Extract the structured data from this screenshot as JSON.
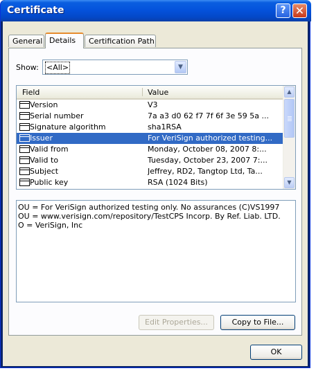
{
  "window": {
    "title": "Certificate"
  },
  "titlebar": {
    "help_glyph": "?",
    "close_glyph": "✕"
  },
  "tabs": [
    {
      "label": "General"
    },
    {
      "label": "Details"
    },
    {
      "label": "Certification Path"
    }
  ],
  "show": {
    "label": "Show:",
    "selected": "<All>"
  },
  "list": {
    "columns": [
      "Field",
      "Value"
    ],
    "rows": [
      {
        "field": "Version",
        "value": "V3"
      },
      {
        "field": "Serial number",
        "value": "7a a3 d0 62 f7 7f 6f 3e 59 5a ..."
      },
      {
        "field": "Signature algorithm",
        "value": "sha1RSA"
      },
      {
        "field": "Issuer",
        "value": "For VeriSign authorized testing..."
      },
      {
        "field": "Valid from",
        "value": "Monday, October 08, 2007 8:..."
      },
      {
        "field": "Valid to",
        "value": "Tuesday, October 23, 2007 7:..."
      },
      {
        "field": "Subject",
        "value": "Jeffrey, RD2, Tangtop Ltd, Ta..."
      },
      {
        "field": "Public key",
        "value": "RSA (1024 Bits)"
      }
    ],
    "selected_index": 3
  },
  "detail": {
    "lines": [
      "OU = For VeriSign authorized testing only. No assurances (C)VS1997",
      "OU = www.verisign.com/repository/TestCPS Incorp. By Ref. Liab. LTD.",
      "O = VeriSign, Inc"
    ]
  },
  "buttons": {
    "edit_properties": "Edit Properties...",
    "copy_to_file": "Copy to File...",
    "ok": "OK"
  },
  "icons": {
    "row_icon": "certificate-field-icon",
    "scroll_up": "chevron-up-icon",
    "scroll_down": "chevron-down-icon",
    "combo_arrow": "chevron-down-icon"
  }
}
